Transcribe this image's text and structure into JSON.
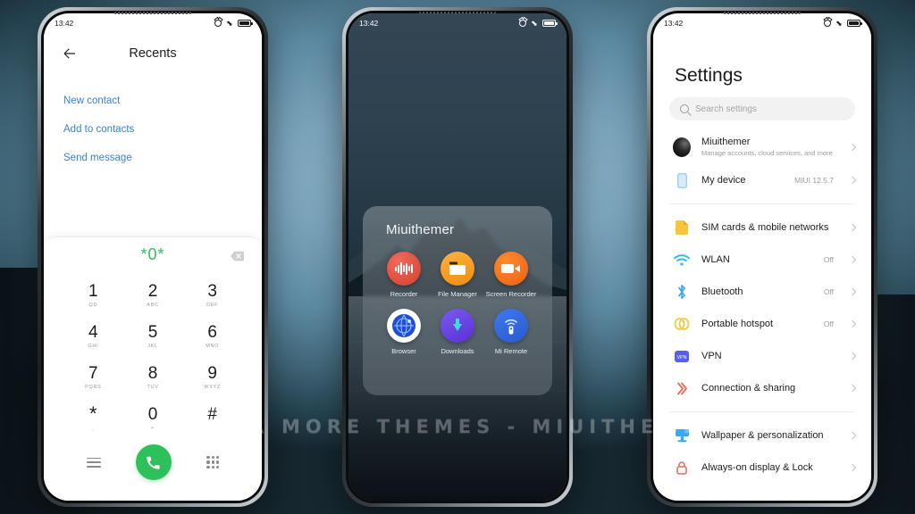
{
  "watermark": "VISIT FOR MORE THEMES - MIUITHEMER.COM",
  "status_bar": {
    "time": "13:42",
    "alarm_icon": "alarm-icon",
    "airplane_icon": "airplane-mode-icon",
    "battery_icon": "battery-icon"
  },
  "phone1": {
    "title": "Recents",
    "back_icon": "back-arrow-icon",
    "links": [
      {
        "label": "New contact"
      },
      {
        "label": "Add to contacts"
      },
      {
        "label": "Send message"
      }
    ],
    "dialer": {
      "number": "*0*",
      "backspace_icon": "backspace-icon",
      "keys": [
        {
          "digit": "1",
          "sub": "QD"
        },
        {
          "digit": "2",
          "sub": "ABC"
        },
        {
          "digit": "3",
          "sub": "DEF"
        },
        {
          "digit": "4",
          "sub": "GHI"
        },
        {
          "digit": "5",
          "sub": "JKL"
        },
        {
          "digit": "6",
          "sub": "MNO"
        },
        {
          "digit": "7",
          "sub": "PQRS"
        },
        {
          "digit": "8",
          "sub": "TUV"
        },
        {
          "digit": "9",
          "sub": "WXYZ"
        },
        {
          "digit": "*",
          "sub": ","
        },
        {
          "digit": "0",
          "sub": "+"
        },
        {
          "digit": "#",
          "sub": ""
        }
      ],
      "menu_icon": "hamburger-menu-icon",
      "call_icon": "call-icon",
      "keypad_icon": "keypad-grid-icon"
    },
    "accent_green": "#2ec05b",
    "link_blue": "#3b82cd"
  },
  "phone2": {
    "folder_title": "Miuithemer",
    "apps": [
      {
        "label": "Recorder",
        "icon": "recorder-icon",
        "color": "#d5402f"
      },
      {
        "label": "File Manager",
        "icon": "file-manager-icon",
        "color": "#f08c12"
      },
      {
        "label": "Screen Recorder",
        "icon": "screen-recorder-icon",
        "color": "#ef5f12"
      },
      {
        "label": "Browser",
        "icon": "browser-icon",
        "color": "#ffffff"
      },
      {
        "label": "Downloads",
        "icon": "downloads-icon",
        "color": "#5b2fd6"
      },
      {
        "label": "Mi Remote",
        "icon": "mi-remote-icon",
        "color": "#2a58cf"
      }
    ]
  },
  "phone3": {
    "title": "Settings",
    "search_placeholder": "Search settings",
    "search_icon": "search-icon",
    "groups": [
      {
        "rows": [
          {
            "label": "Miuithemer",
            "sub": "Manage accounts, cloud services, and more",
            "value": "",
            "icon": "account-avatar"
          },
          {
            "label": "My device",
            "sub": "",
            "value": "MIUI 12.5.7",
            "icon": "device-icon"
          }
        ]
      },
      {
        "rows": [
          {
            "label": "SIM cards & mobile networks",
            "sub": "",
            "value": "",
            "icon": "sim-card-icon"
          },
          {
            "label": "WLAN",
            "sub": "",
            "value": "Off",
            "icon": "wifi-icon"
          },
          {
            "label": "Bluetooth",
            "sub": "",
            "value": "Off",
            "icon": "bluetooth-icon"
          },
          {
            "label": "Portable hotspot",
            "sub": "",
            "value": "Off",
            "icon": "hotspot-icon"
          },
          {
            "label": "VPN",
            "sub": "",
            "value": "",
            "icon": "vpn-icon"
          },
          {
            "label": "Connection & sharing",
            "sub": "",
            "value": "",
            "icon": "connection-sharing-icon"
          }
        ]
      },
      {
        "rows": [
          {
            "label": "Wallpaper & personalization",
            "sub": "",
            "value": "",
            "icon": "wallpaper-icon"
          },
          {
            "label": "Always-on display & Lock",
            "sub": "",
            "value": "",
            "icon": "aod-lock-icon"
          }
        ]
      }
    ]
  }
}
